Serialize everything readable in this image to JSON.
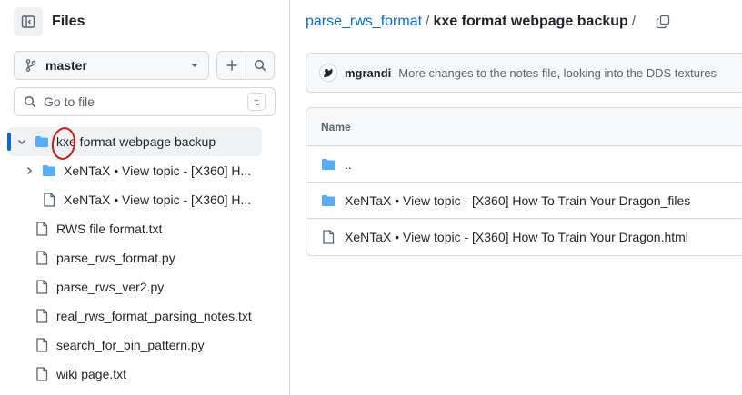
{
  "sidebar": {
    "title": "Files",
    "branch": "master",
    "goto_placeholder": "Go to file",
    "goto_shortcut": "t",
    "tree": [
      {
        "label": "kxe format webpage backup",
        "type": "folder",
        "expanded": true,
        "depth": 0
      },
      {
        "label": "XeNTaX • View topic - [X360] H...",
        "type": "folder",
        "expanded": false,
        "depth": 1
      },
      {
        "label": "XeNTaX • View topic - [X360] H...",
        "type": "file",
        "depth": 1
      },
      {
        "label": "RWS file format.txt",
        "type": "file",
        "depth": 0
      },
      {
        "label": "parse_rws_format.py",
        "type": "file",
        "depth": 0
      },
      {
        "label": "parse_rws_ver2.py",
        "type": "file",
        "depth": 0
      },
      {
        "label": "real_rws_format_parsing_notes.txt",
        "type": "file",
        "depth": 0
      },
      {
        "label": "search_for_bin_pattern.py",
        "type": "file",
        "depth": 0
      },
      {
        "label": "wiki page.txt",
        "type": "file",
        "depth": 0
      }
    ]
  },
  "main": {
    "breadcrumb": {
      "repo": "parse_rws_format",
      "sep": "/",
      "current": "kxe format webpage backup",
      "trail": "/"
    },
    "commit": {
      "author": "mgrandi",
      "message": "More changes to the notes file, looking into the DDS textures"
    },
    "table": {
      "header": "Name",
      "rows": [
        {
          "name": "..",
          "type": "folder"
        },
        {
          "name": "XeNTaX • View topic - [X360] How To Train Your Dragon_files",
          "type": "folder"
        },
        {
          "name": "XeNTaX • View topic - [X360] How To Train Your Dragon.html",
          "type": "file"
        }
      ]
    }
  },
  "colors": {
    "accent": "#0969da",
    "folder": "#54aeff",
    "annotation": "#dd1111"
  }
}
